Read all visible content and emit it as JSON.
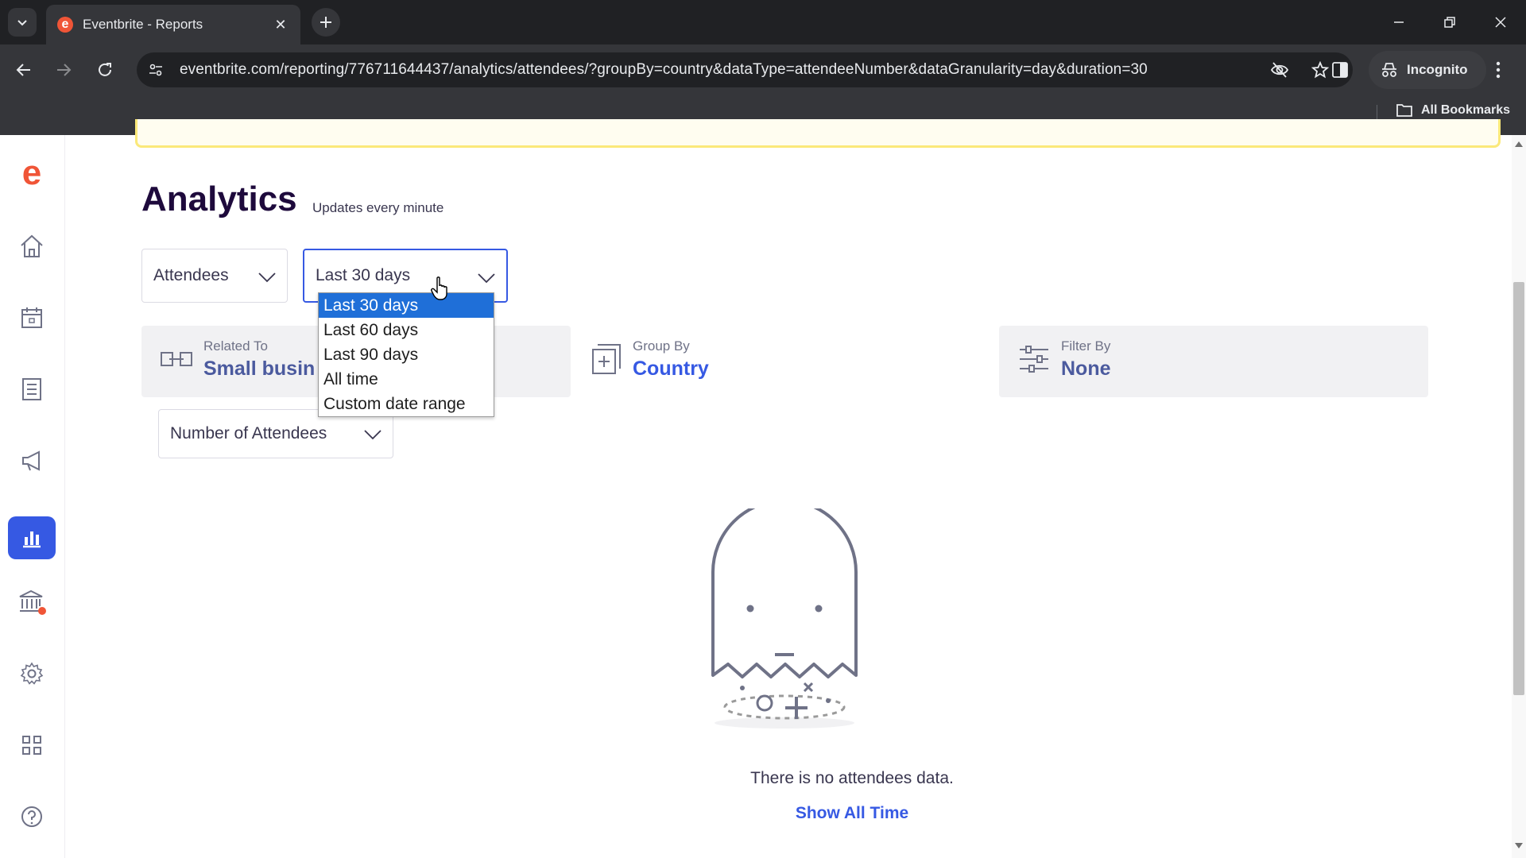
{
  "browser": {
    "tab_title": "Eventbrite - Reports",
    "url": "eventbrite.com/reporting/776711644437/analytics/attendees/?groupBy=country&dataType=attendeeNumber&dataGranularity=day&duration=30",
    "incognito_label": "Incognito",
    "bookmarks_label": "All Bookmarks"
  },
  "sidebar": {
    "items": [
      {
        "name": "home",
        "icon": "home-icon"
      },
      {
        "name": "events",
        "icon": "calendar-icon"
      },
      {
        "name": "orders",
        "icon": "list-icon"
      },
      {
        "name": "marketing",
        "icon": "megaphone-icon"
      },
      {
        "name": "reports",
        "icon": "bar-chart-icon",
        "active": true
      },
      {
        "name": "finance",
        "icon": "bank-icon"
      },
      {
        "name": "settings",
        "icon": "gear-icon"
      },
      {
        "name": "apps",
        "icon": "grid-icon"
      },
      {
        "name": "help",
        "icon": "help-icon"
      }
    ],
    "accent": "#3659e3",
    "notification_dot": "#f05537"
  },
  "page": {
    "title": "Analytics",
    "subtitle": "Updates every minute"
  },
  "filters": {
    "report_type": "Attendees",
    "duration": "Last 30 days",
    "duration_options": [
      "Last 30 days",
      "Last 60 days",
      "Last 90 days",
      "All time",
      "Custom date range"
    ],
    "metric": "Number of Attendees"
  },
  "cards": {
    "related_to": {
      "label": "Related To",
      "value": "Small busin"
    },
    "group_by": {
      "label": "Group By",
      "value": "Country"
    },
    "filter_by": {
      "label": "Filter By",
      "value": "None"
    }
  },
  "empty_state": {
    "message": "There is no attendees data.",
    "link": "Show All Time"
  }
}
